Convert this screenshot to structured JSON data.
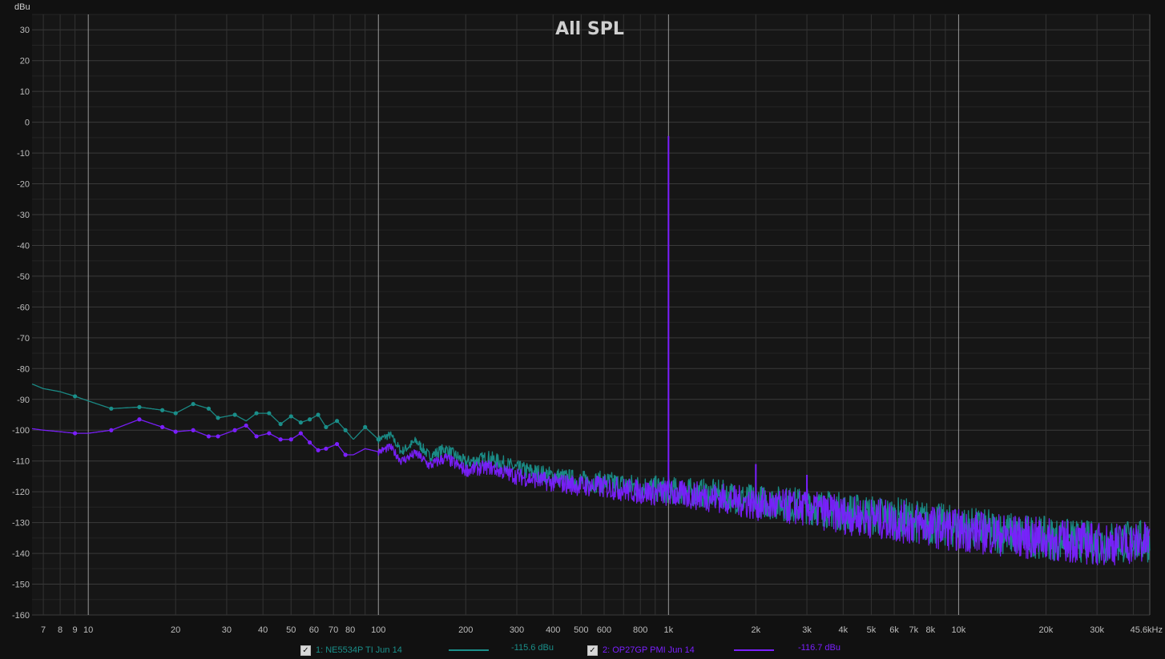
{
  "chart_data": {
    "type": "line",
    "title": "All SPL",
    "ylabel": "dBu",
    "xlabel": "",
    "x_scale": "log",
    "xlim": [
      6.4,
      45600
    ],
    "ylim": [
      -160,
      35
    ],
    "grid": true,
    "y_ticks": [
      30,
      20,
      10,
      0,
      -10,
      -20,
      -30,
      -40,
      -50,
      -60,
      -70,
      -80,
      -90,
      -100,
      -110,
      -120,
      -130,
      -140,
      -150,
      -160
    ],
    "x_ticks": [
      {
        "v": 7,
        "label": "7"
      },
      {
        "v": 8,
        "label": "8"
      },
      {
        "v": 9,
        "label": "9"
      },
      {
        "v": 10,
        "label": "10"
      },
      {
        "v": 20,
        "label": "20"
      },
      {
        "v": 30,
        "label": "30"
      },
      {
        "v": 40,
        "label": "40"
      },
      {
        "v": 50,
        "label": "50"
      },
      {
        "v": 60,
        "label": "60"
      },
      {
        "v": 70,
        "label": "70"
      },
      {
        "v": 80,
        "label": "80"
      },
      {
        "v": 100,
        "label": "100"
      },
      {
        "v": 200,
        "label": "200"
      },
      {
        "v": 300,
        "label": "300"
      },
      {
        "v": 400,
        "label": "400"
      },
      {
        "v": 500,
        "label": "500"
      },
      {
        "v": 600,
        "label": "600"
      },
      {
        "v": 800,
        "label": "800"
      },
      {
        "v": 1000,
        "label": "1k"
      },
      {
        "v": 2000,
        "label": "2k"
      },
      {
        "v": 3000,
        "label": "3k"
      },
      {
        "v": 4000,
        "label": "4k"
      },
      {
        "v": 5000,
        "label": "5k"
      },
      {
        "v": 6000,
        "label": "6k"
      },
      {
        "v": 7000,
        "label": "7k"
      },
      {
        "v": 8000,
        "label": "8k"
      },
      {
        "v": 10000,
        "label": "10k"
      },
      {
        "v": 20000,
        "label": "20k"
      },
      {
        "v": 30000,
        "label": "30k"
      },
      {
        "v": 45600,
        "label": "45.6kHz"
      }
    ],
    "series": [
      {
        "name": "1: NE5534P TI Jun 14",
        "color": "#1a8f8a",
        "level": "-115.6 dBu",
        "points": [
          [
            6.4,
            -85
          ],
          [
            7,
            -86.5
          ],
          [
            8,
            -87.5
          ],
          [
            9,
            -89
          ],
          [
            10,
            -90.5
          ],
          [
            12,
            -93
          ],
          [
            15,
            -92.5
          ],
          [
            18,
            -93.5
          ],
          [
            20,
            -94.5
          ],
          [
            23,
            -91.5
          ],
          [
            26,
            -93
          ],
          [
            28,
            -96
          ],
          [
            32,
            -95
          ],
          [
            35,
            -97
          ],
          [
            38,
            -94.5
          ],
          [
            42,
            -94.5
          ],
          [
            46,
            -98
          ],
          [
            50,
            -95.5
          ],
          [
            54,
            -97.5
          ],
          [
            58,
            -96.5
          ],
          [
            62,
            -95
          ],
          [
            66,
            -99
          ],
          [
            72,
            -97
          ],
          [
            77,
            -100
          ],
          [
            82,
            -103
          ],
          [
            90,
            -99
          ],
          [
            100,
            -103
          ],
          [
            110,
            -101.5
          ],
          [
            120,
            -107
          ],
          [
            135,
            -103.5
          ],
          [
            150,
            -108.5
          ],
          [
            170,
            -106
          ],
          [
            200,
            -110.5
          ],
          [
            240,
            -109
          ],
          [
            300,
            -112.5
          ],
          [
            400,
            -115
          ],
          [
            500,
            -116.5
          ],
          [
            600,
            -117
          ],
          [
            800,
            -118.5
          ],
          [
            1000,
            -119.5
          ],
          [
            1500,
            -121
          ],
          [
            2000,
            -123
          ],
          [
            3000,
            -124.5
          ],
          [
            4000,
            -126.5
          ],
          [
            6000,
            -128.5
          ],
          [
            10000,
            -131.5
          ],
          [
            20000,
            -135
          ],
          [
            30000,
            -136.5
          ],
          [
            45600,
            -136
          ]
        ],
        "markers": [
          [
            9,
            -89
          ],
          [
            12,
            -93
          ],
          [
            15,
            -92.5
          ],
          [
            18,
            -93.5
          ],
          [
            20,
            -94.5
          ],
          [
            23,
            -91.5
          ],
          [
            26,
            -93
          ],
          [
            28,
            -96
          ],
          [
            32,
            -95
          ],
          [
            38,
            -94.5
          ],
          [
            42,
            -94.5
          ],
          [
            46,
            -98
          ],
          [
            50,
            -95.5
          ],
          [
            54,
            -97.5
          ],
          [
            58,
            -96.5
          ],
          [
            62,
            -95
          ],
          [
            66,
            -99
          ],
          [
            72,
            -97
          ],
          [
            77,
            -100
          ],
          [
            90,
            -99
          ],
          [
            100,
            -103
          ]
        ],
        "peaks": []
      },
      {
        "name": "2: OP27GP PMI Jun 14",
        "color": "#7b1fff",
        "level": "-116.7 dBu",
        "points": [
          [
            6.4,
            -99.5
          ],
          [
            7,
            -100
          ],
          [
            8,
            -100.5
          ],
          [
            9,
            -101
          ],
          [
            10,
            -101
          ],
          [
            12,
            -100
          ],
          [
            15,
            -96.5
          ],
          [
            18,
            -99
          ],
          [
            20,
            -100.5
          ],
          [
            23,
            -100
          ],
          [
            26,
            -102
          ],
          [
            28,
            -102
          ],
          [
            32,
            -100
          ],
          [
            35,
            -98.5
          ],
          [
            38,
            -102
          ],
          [
            42,
            -101
          ],
          [
            46,
            -103
          ],
          [
            50,
            -103
          ],
          [
            54,
            -101
          ],
          [
            58,
            -104
          ],
          [
            62,
            -106.5
          ],
          [
            66,
            -106
          ],
          [
            72,
            -104.5
          ],
          [
            77,
            -108
          ],
          [
            82,
            -108
          ],
          [
            90,
            -106
          ],
          [
            100,
            -107
          ],
          [
            110,
            -105.5
          ],
          [
            120,
            -110
          ],
          [
            135,
            -107.5
          ],
          [
            150,
            -111.5
          ],
          [
            170,
            -109
          ],
          [
            200,
            -113
          ],
          [
            240,
            -112
          ],
          [
            300,
            -115
          ],
          [
            400,
            -117
          ],
          [
            500,
            -118
          ],
          [
            600,
            -118.5
          ],
          [
            800,
            -120
          ],
          [
            1000,
            -120.5
          ],
          [
            1500,
            -122
          ],
          [
            2000,
            -124
          ],
          [
            3000,
            -125.5
          ],
          [
            4000,
            -127.5
          ],
          [
            6000,
            -129.5
          ],
          [
            10000,
            -132.5
          ],
          [
            20000,
            -135.5
          ],
          [
            30000,
            -137
          ],
          [
            45600,
            -136.5
          ]
        ],
        "markers": [
          [
            9,
            -101
          ],
          [
            12,
            -100
          ],
          [
            15,
            -96.5
          ],
          [
            18,
            -99
          ],
          [
            20,
            -100.5
          ],
          [
            23,
            -100
          ],
          [
            26,
            -102
          ],
          [
            28,
            -102
          ],
          [
            32,
            -100
          ],
          [
            35,
            -98.5
          ],
          [
            38,
            -102
          ],
          [
            42,
            -101
          ],
          [
            46,
            -103
          ],
          [
            50,
            -103
          ],
          [
            54,
            -101
          ],
          [
            58,
            -104
          ],
          [
            62,
            -106.5
          ],
          [
            66,
            -106
          ],
          [
            72,
            -104.5
          ],
          [
            77,
            -108
          ]
        ],
        "peaks": [
          [
            1000,
            -4.5
          ],
          [
            2000,
            -111
          ],
          [
            3000,
            -114.5
          ]
        ]
      }
    ]
  }
}
